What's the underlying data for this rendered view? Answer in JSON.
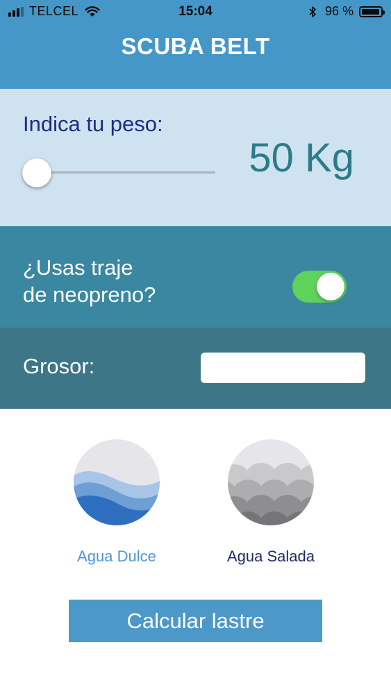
{
  "status_bar": {
    "carrier": "TELCEL",
    "time": "15:04",
    "battery_percent": "96 %",
    "battery_level": 0.96,
    "signal_bars": 3,
    "signal_max": 4
  },
  "header": {
    "title": "SCUBA BELT",
    "color": "#4597c8"
  },
  "weight": {
    "label": "Indica tu peso:",
    "value_text": "50 Kg",
    "slider_level": 0.0
  },
  "neoprene": {
    "question_line1": "¿Usas traje",
    "question_line2": "de neopreno?",
    "toggle_on": true,
    "toggle_color": "#5ed25a"
  },
  "thickness": {
    "label": "Grosor:",
    "value": "",
    "placeholder": ""
  },
  "water_options": {
    "fresh": {
      "label": "Agua Dulce",
      "icon": "fresh-water-wave-icon",
      "selected": true
    },
    "salt": {
      "label": "Agua Salada",
      "icon": "salt-water-scales-icon",
      "selected": false
    }
  },
  "actions": {
    "calculate_label": "Calcular lastre"
  }
}
